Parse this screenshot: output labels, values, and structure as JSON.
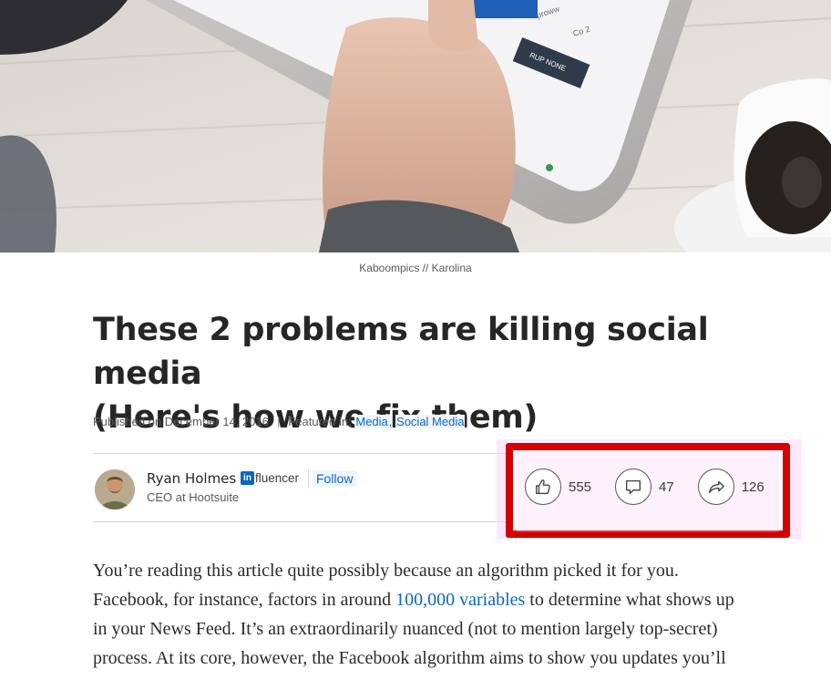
{
  "photo": {
    "caption": "Kaboompics // Karolina",
    "screen_texts": [
      "proww",
      "Co 2",
      "RUP NONE"
    ]
  },
  "article": {
    "title_line1": "These 2 problems are killing social media",
    "title_line2": "(Here's how we fix them)",
    "published": "Published on December 14, 2016",
    "featured_label": "Featured in:",
    "topics": [
      "Media",
      "Social Media"
    ],
    "topic_separator": ","
  },
  "author": {
    "name": "Ryan Holmes",
    "badge_in": "in",
    "badge_text": "fluencer",
    "follow_label": "Follow",
    "title": "CEO at Hootsuite"
  },
  "social": {
    "likes": "555",
    "comments": "47",
    "shares": "126"
  },
  "body": {
    "line1": "You’re reading this article quite possibly because an algorithm picked it for you.",
    "line2_before": "Facebook, for instance, factors in around ",
    "line2_link": "100,000 variables",
    "line2_after": " to determine what shows up",
    "line3": "in your News Feed. It’s an extraordinarily nuanced (not to mention largely top-secret)",
    "line4": "process. At its core, however, the Facebook algorithm aims to show you updates you’ll"
  },
  "colors": {
    "link": "#0a66c2",
    "highlight_border": "#d40000"
  }
}
